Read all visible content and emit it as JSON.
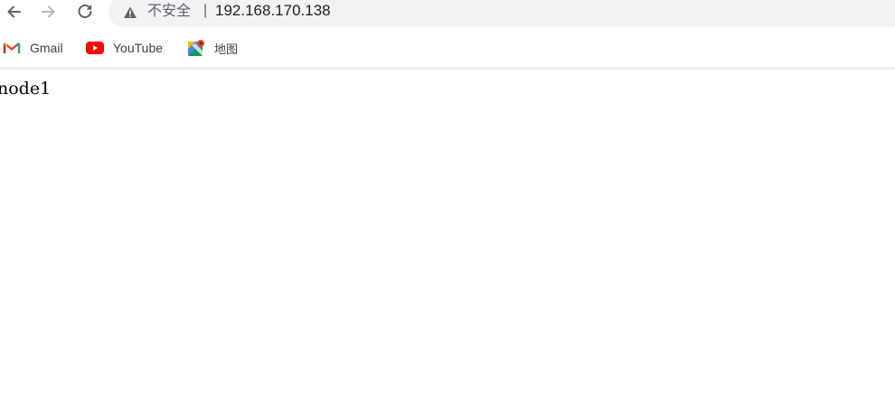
{
  "toolbar": {
    "back_icon": "arrow-left-icon",
    "forward_icon": "arrow-right-icon",
    "reload_icon": "reload-icon",
    "security_icon": "warning-triangle-icon",
    "security_label": "不安全",
    "separator": "|",
    "url": "192.168.170.138"
  },
  "bookmarks": [
    {
      "label": "Gmail",
      "icon": "gmail-icon"
    },
    {
      "label": "YouTube",
      "icon": "youtube-icon"
    },
    {
      "label": "地图",
      "icon": "maps-icon"
    }
  ],
  "page": {
    "body_text": "node1"
  },
  "colors": {
    "omnibox_bg": "#f1f3f4",
    "youtube_red": "#ff0000",
    "gmail_red": "#ea4335"
  }
}
